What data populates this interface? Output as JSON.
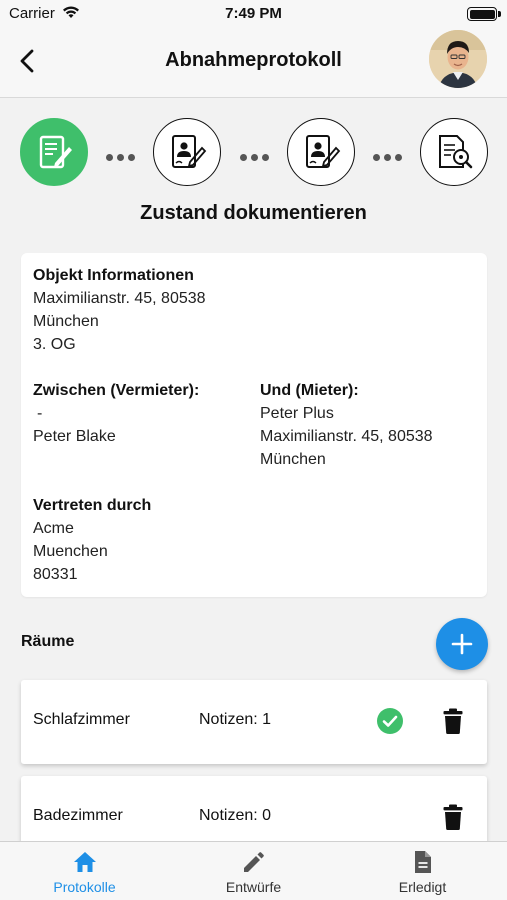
{
  "status_bar": {
    "carrier": "Carrier",
    "time": "7:49 PM"
  },
  "header": {
    "title": "Abnahmeprotokoll"
  },
  "stepper": {
    "steps": [
      {
        "icon": "document-edit-icon",
        "active": true
      },
      {
        "icon": "person-document-edit-icon",
        "active": false
      },
      {
        "icon": "person-document-edit-icon",
        "active": false
      },
      {
        "icon": "document-review-icon",
        "active": false
      }
    ],
    "title": "Zustand dokumentieren"
  },
  "info": {
    "object": {
      "label": "Objekt Informationen",
      "street": "Maximilianstr. 45, 80538",
      "city": "München",
      "floor": "3. OG"
    },
    "landlord": {
      "label": "Zwischen (Vermieter):",
      "line1": "-",
      "name": "Peter Blake"
    },
    "tenant": {
      "label": "Und (Mieter):",
      "name": "Peter Plus",
      "street": "Maximilianstr. 45, 80538",
      "city": "München"
    },
    "representative": {
      "label": "Vertreten durch",
      "name": "Acme",
      "city": "Muenchen",
      "zip": "80331"
    }
  },
  "rooms": {
    "label": "Räume",
    "items": [
      {
        "name": "Schlafzimmer",
        "notes": "Notizen: 1",
        "done": true
      },
      {
        "name": "Badezimmer",
        "notes": "Notizen: 0",
        "done": false
      }
    ]
  },
  "tabbar": {
    "tabs": [
      {
        "label": "Protokolle",
        "icon": "home-icon",
        "active": true
      },
      {
        "label": "Entwürfe",
        "icon": "pencil-icon",
        "active": false
      },
      {
        "label": "Erledigt",
        "icon": "document-icon",
        "active": false
      }
    ]
  },
  "colors": {
    "accent": "#1e8fe6",
    "success": "#3fbf6b"
  }
}
